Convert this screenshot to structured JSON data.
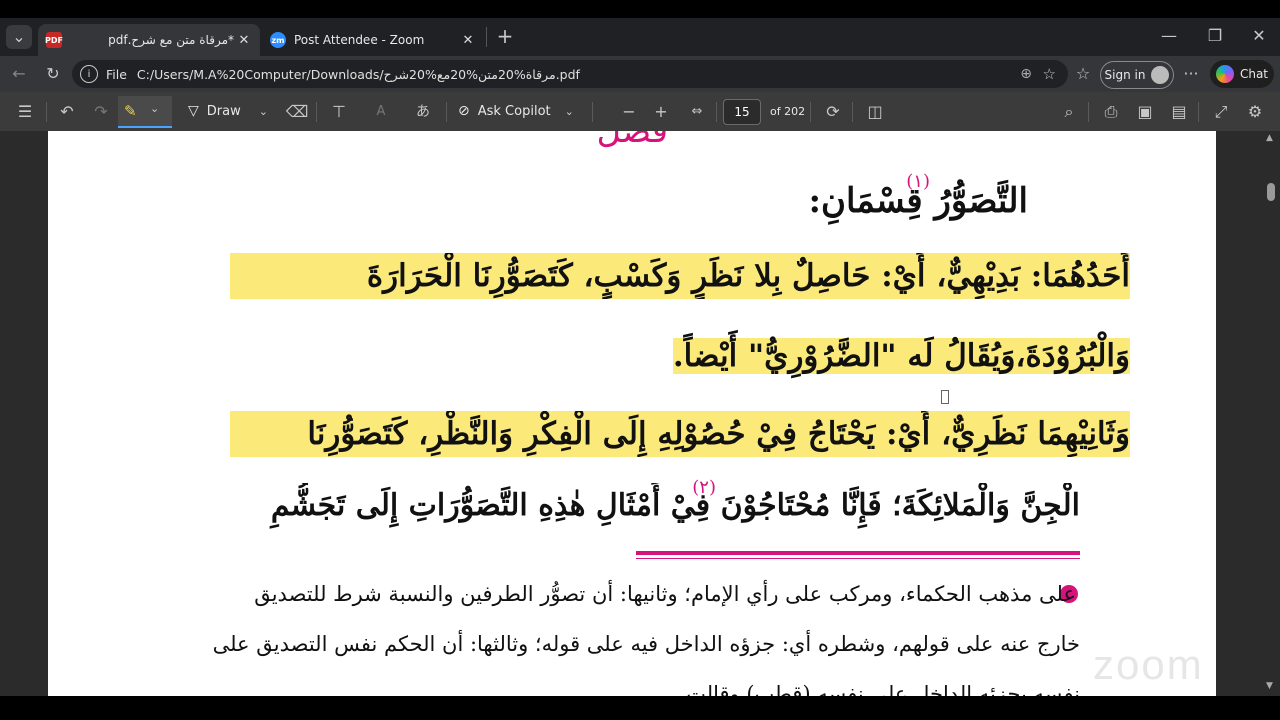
{
  "tabs": [
    {
      "title": "*مرقاة متن مع شرح.pdf",
      "icon": "pdf-icon"
    },
    {
      "title": "Post Attendee - Zoom",
      "icon": "zoom-icon"
    }
  ],
  "address": {
    "scheme_label": "File",
    "url": "C:/Users/M.A%20Computer/Downloads/مرقاة%20متن%20مع%20شرح.pdf"
  },
  "signin_label": "Sign in",
  "chat_label": "Chat",
  "pdf_toolbar": {
    "draw_label": "Draw",
    "copilot_label": "Ask Copilot",
    "page_current": "15",
    "page_total": "of 202"
  },
  "document": {
    "heading": "فصل",
    "line1": "التَّصَوُّرُ قِسْمَانِ:",
    "fn1": "(١)",
    "line2": "أَحَدُهُمَا: بَدِيْهِيٌّ، أَيْ: حَاصِلٌ بِلا نَظَرٍ وَكَسْبٍ، كَتَصَوُّرِنَا الْحَرَارَةَ",
    "line3": "وَالْبُرُوْدَةَ،وَيُقَالُ لَه \"الضَّرُوْرِيُّ\" أَيْضاً.",
    "line4": "وَثَانِيْهِمَا نَظَرِيٌّ، أَيْ: يَحْتَاجُ فِيْ حُصُوْلِهِ إِلَى الْفِكْرِ وَالنَّظْرِ، كَتَصَوُّرِنَا",
    "line5": "الْجِنَّ وَالْمَلائِكَةَ؛ فَإِنَّا مُحْتَاجُوْنَ فِيْ أَمْثَالِ هٰذِهِ التَّصَوُّرَاتِ إِلَى تَجَشُّمِ",
    "fn2": "(٢)",
    "fnline1": "على مذهب الحكماء، ومركب على رأي الإمام؛ وثانيها: أن تصوُّر الطرفين والنسبة شرط للتصديق",
    "fnline2": "خارج عنه على قولهم، وشطره أي: جزؤه الداخل فيه على قوله؛ وثالثها: أن الحكم نفس التصديق على",
    "fnline3": "نفسه بجزئه الداخل على نفسه (قطب) وقالت",
    "watermark": "zoom"
  },
  "colors": {
    "highlight": "#fbe97a",
    "accent_pink": "#d6137a",
    "chrome_dark": "#202124",
    "chrome_mid": "#35363a"
  }
}
